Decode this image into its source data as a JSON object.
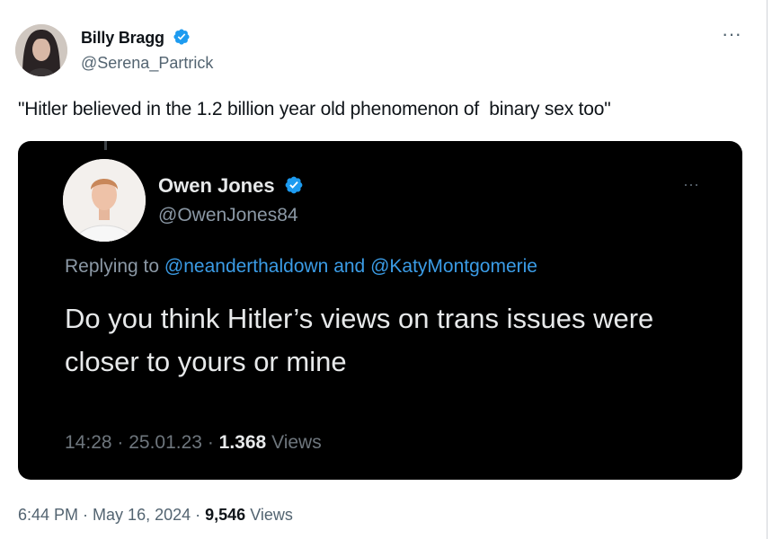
{
  "tweet": {
    "author_name": "Billy Bragg",
    "handle": "@Serena_Partrick",
    "text": "\"Hitler believed in the 1.2 billion year old phenomenon of  binary sex too\"",
    "time": "6:44 PM",
    "date": "May 16, 2024",
    "views_count": "9,546",
    "views_label": "Views",
    "more_label": "···"
  },
  "embedded": {
    "author_name": "Owen Jones",
    "handle": "@OwenJones84",
    "replying_prefix": "Replying to ",
    "reply_mention_1": "@neanderthaldown",
    "reply_and": " and ",
    "reply_mention_2": "@KatyMontgomerie",
    "text": "Do you think Hitler’s views on trans issues were closer to yours or mine",
    "time": "14:28",
    "date": "25.01.23",
    "views_count": "1.368",
    "views_label": "Views",
    "more_label": "···"
  },
  "colors": {
    "verified": "#1d9bf0",
    "mention": "#3b9ce6",
    "muted": "#536471"
  },
  "icons": {
    "verified": "verified-badge-icon",
    "more": "more-options-icon"
  }
}
